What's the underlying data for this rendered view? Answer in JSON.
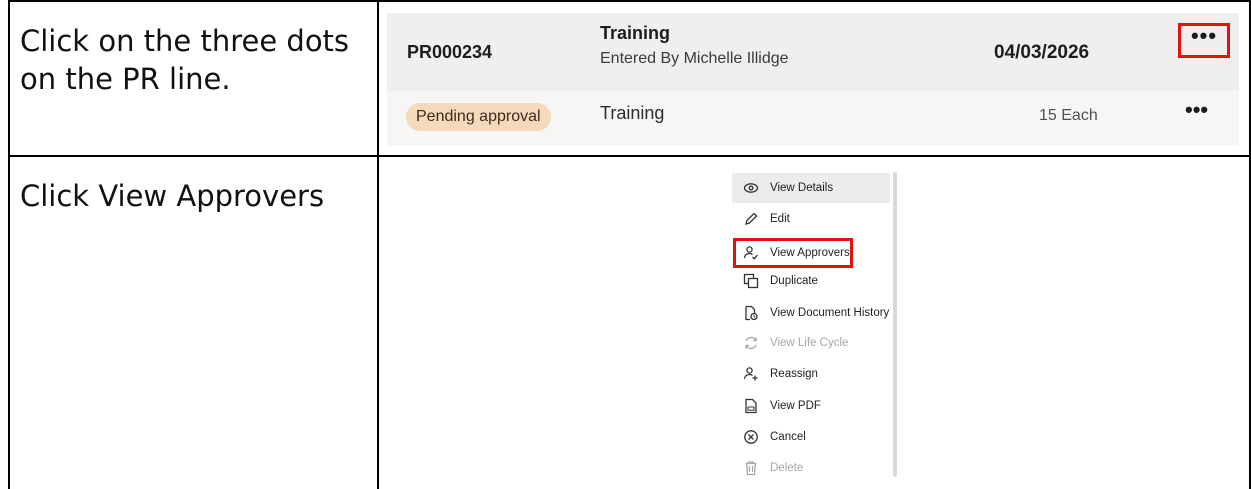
{
  "steps": [
    {
      "instruction": "Click on the three dots on the PR line."
    },
    {
      "instruction": "Click View Approvers"
    }
  ],
  "pr_line": {
    "number": "PR000234",
    "title": "Training",
    "entered_by": "Entered By Michelle Illidge",
    "date": "04/03/2026",
    "status": "Pending approval",
    "item": "Training",
    "quantity": "15 Each",
    "more_label": "•••",
    "highlight_color": "#e01212"
  },
  "menu": {
    "items": [
      {
        "label": "View Details",
        "icon": "eye-icon"
      },
      {
        "label": "Edit",
        "icon": "pencil-icon"
      },
      {
        "label": "View Approvers",
        "icon": "user-check-icon"
      },
      {
        "label": "Duplicate",
        "icon": "duplicate-icon"
      },
      {
        "label": "View Document History",
        "icon": "document-history-icon"
      },
      {
        "label": "View Life Cycle",
        "icon": "life-cycle-icon",
        "disabled": true
      },
      {
        "label": "Reassign",
        "icon": "user-plus-icon"
      },
      {
        "label": "View PDF",
        "icon": "pdf-icon"
      },
      {
        "label": "Cancel",
        "icon": "cancel-circle-icon"
      },
      {
        "label": "Delete",
        "icon": "trash-icon",
        "disabled": true
      }
    ]
  }
}
